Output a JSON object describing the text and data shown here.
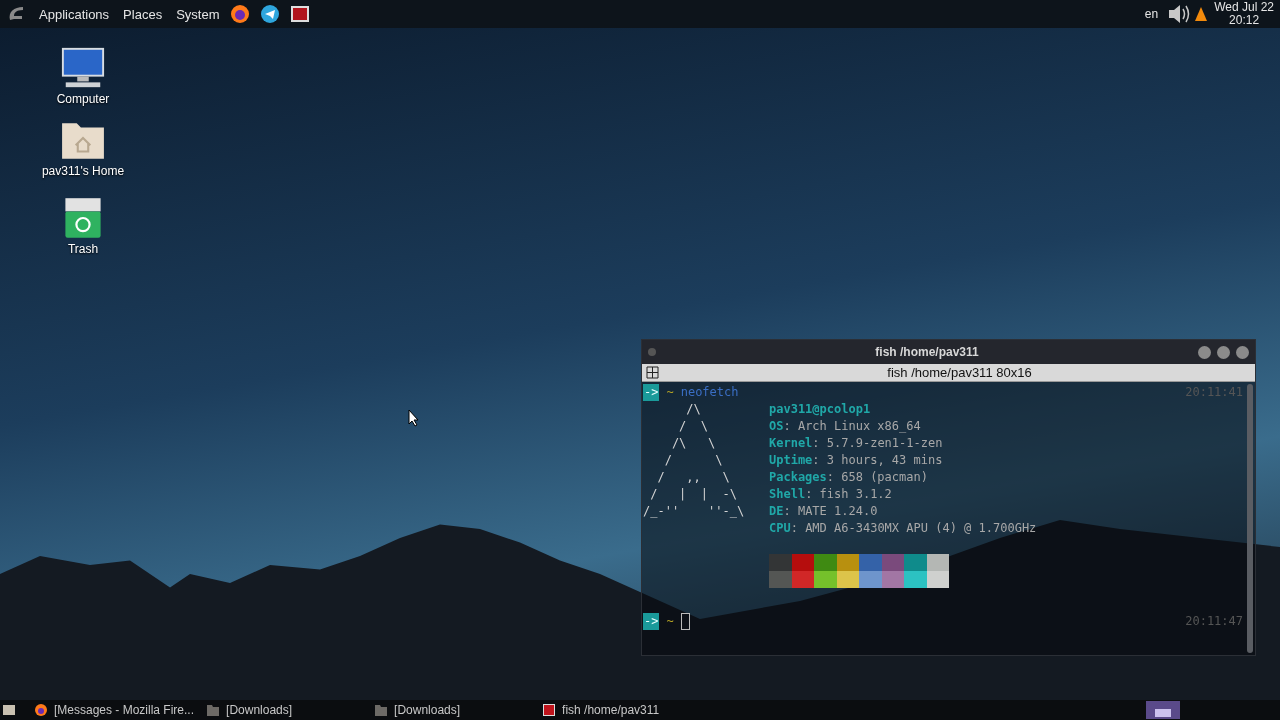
{
  "top_panel": {
    "menus": [
      "Applications",
      "Places",
      "System"
    ],
    "keyboard_layout": "en",
    "clock_date": "Wed Jul 22",
    "clock_time": "20:12"
  },
  "desktop_icons": [
    {
      "kind": "computer",
      "label": "Computer"
    },
    {
      "kind": "home",
      "label": "pav311's Home"
    },
    {
      "kind": "trash",
      "label": "Trash"
    }
  ],
  "terminal": {
    "title": "fish /home/pav311",
    "tab_title": "fish /home/pav311 80x16",
    "prompt_1": {
      "arrow": "->",
      "dir": "~",
      "command": "neofetch",
      "time": "20:11:41"
    },
    "art": [
      "      /\\",
      "     /  \\",
      "    /\\   \\",
      "   /      \\",
      "  /   ,,   \\",
      " /   |  |  -\\",
      "/_-''    ''-_\\"
    ],
    "header": "pav311@pcolop1",
    "info": [
      "**OS**: Arch Linux x86_64",
      "**Kernel**: 5.7.9-zen1-1-zen",
      "**Uptime**: 3 hours, 43 mins",
      "**Packages**: 658 (pacman)",
      "**Shell**: fish 3.1.2",
      "**DE**: MATE 1.24.0",
      "**CPU**: AMD A6-3430MX APU (4) @ 1.700GHz"
    ],
    "palette": [
      [
        {
          "color": "#333536"
        },
        {
          "color": "#b50d0d"
        },
        {
          "color": "#3f8a12"
        },
        {
          "color": "#b8900f"
        },
        {
          "color": "#3462a8"
        },
        {
          "color": "#7a4a7c"
        },
        {
          "color": "#0f8b8b"
        },
        {
          "color": "#b4b7b4"
        }
      ],
      [
        {
          "color": "#545654"
        },
        {
          "color": "#d12727"
        },
        {
          "color": "#75c12b"
        },
        {
          "color": "#dcc44a"
        },
        {
          "color": "#6e95cc"
        },
        {
          "color": "#a276a4"
        },
        {
          "color": "#2cc2c2"
        },
        {
          "color": "#cfd0ce"
        }
      ]
    ],
    "prompt_2": {
      "arrow": "->",
      "dir": "~",
      "time": "20:11:47"
    }
  },
  "taskbar": [
    {
      "kind": "firefox",
      "label": "[Messages - Mozilla Fire..."
    },
    {
      "kind": "folder",
      "label": "[Downloads]"
    },
    {
      "kind": "folder",
      "label": "[Downloads]"
    },
    {
      "kind": "terminal",
      "label": "fish /home/pav311"
    }
  ]
}
